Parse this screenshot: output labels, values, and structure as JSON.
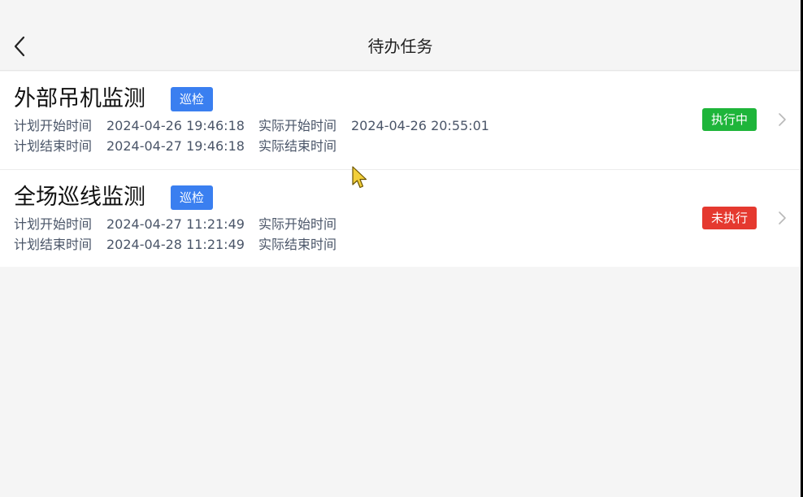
{
  "header": {
    "title": "待办任务"
  },
  "labels": {
    "plan_start": "计划开始时间",
    "plan_end": "计划结束时间",
    "actual_start": "实际开始时间",
    "actual_end": "实际结束时间"
  },
  "tasks": [
    {
      "name": "外部吊机监测",
      "type": "巡检",
      "plan_start": "2024-04-26 19:46:18",
      "plan_end": "2024-04-27 19:46:18",
      "actual_start": "2024-04-26 20:55:01",
      "actual_end": "",
      "status": "执行中",
      "status_color": "#1eb53a"
    },
    {
      "name": "全场巡线监测",
      "type": "巡检",
      "plan_start": "2024-04-27 11:21:49",
      "plan_end": "2024-04-28 11:21:49",
      "actual_start": "",
      "actual_end": "",
      "status": "未执行",
      "status_color": "#e5392f"
    }
  ]
}
